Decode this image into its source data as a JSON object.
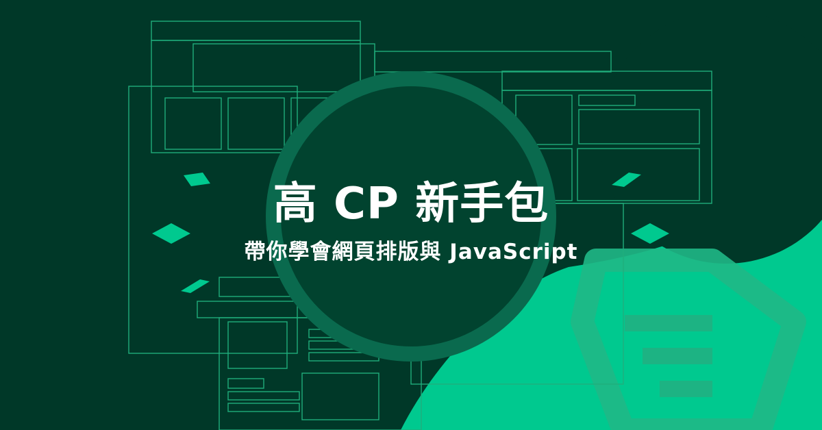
{
  "banner": {
    "title": "高 CP 新手包",
    "subtitle": "帶你學會網頁排版與 JavaScript"
  },
  "colors": {
    "background": "#003828",
    "accent": "#00c98f",
    "outline": "#1fae7c",
    "circle_fill": "#01432f",
    "circle_ring": "#0a6a4e",
    "text": "#ffffff"
  },
  "icons": [
    "hexagon-icon",
    "list-lines-icon",
    "diamond-icon"
  ]
}
